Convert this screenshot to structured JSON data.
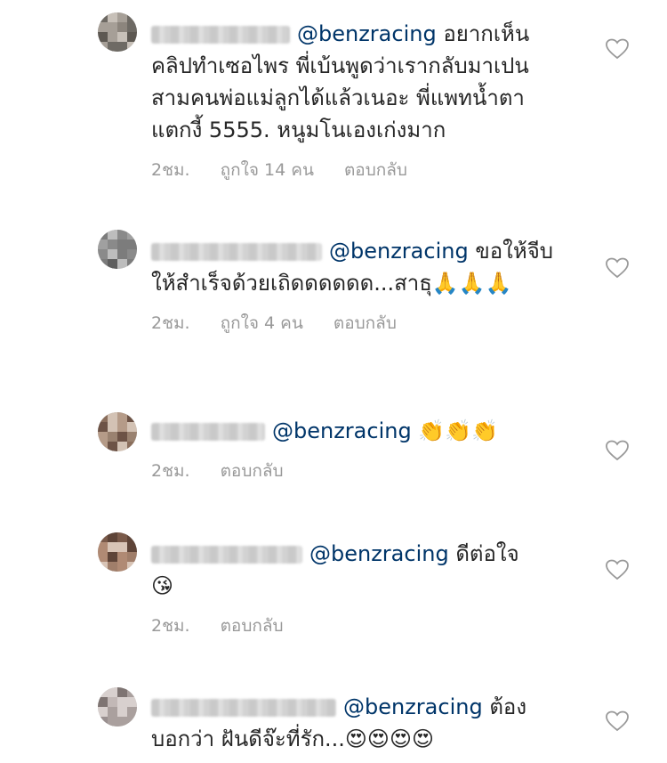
{
  "comments": [
    {
      "mention": "@benzracing",
      "text": "อยากเห็นคลิปทำเซอไพร พี่เบ้นพูดว่าเรากลับมาเปนสามคนพ่อแม่ลูกได้แล้วเนอะ พี่แพทน้ำตาแตกงี้ 5555. หนูมโนเองเก่งมาก",
      "emoji": "",
      "time": "2ชม.",
      "likes": "ถูกใจ 14 คน",
      "reply": "ตอบกลับ"
    },
    {
      "mention": "@benzracing",
      "text": "ขอให้จีบให้สำเร็จด้วยเถิดดดดดด...สาธุ",
      "emoji": "🙏🙏🙏",
      "time": "2ชม.",
      "likes": "ถูกใจ 4 คน",
      "reply": "ตอบกลับ"
    },
    {
      "mention": "@benzracing",
      "text": "",
      "emoji": "👏👏👏",
      "time": "2ชม.",
      "likes": "",
      "reply": "ตอบกลับ"
    },
    {
      "mention": "@benzracing",
      "text": "ดีต่อใจ",
      "emoji": "😘",
      "time": "2ชม.",
      "likes": "",
      "reply": "ตอบกลับ"
    },
    {
      "mention": "@benzracing",
      "text": "ต้องบอกว่า ฝันดีจ๊ะที่รัก...",
      "emoji": "😍😍😍😍",
      "time": "",
      "likes": "",
      "reply": ""
    }
  ],
  "colors": {
    "mention": "#003569",
    "meta": "#999999",
    "text": "#262626"
  },
  "icons": {
    "like": "heart-outline-icon"
  }
}
